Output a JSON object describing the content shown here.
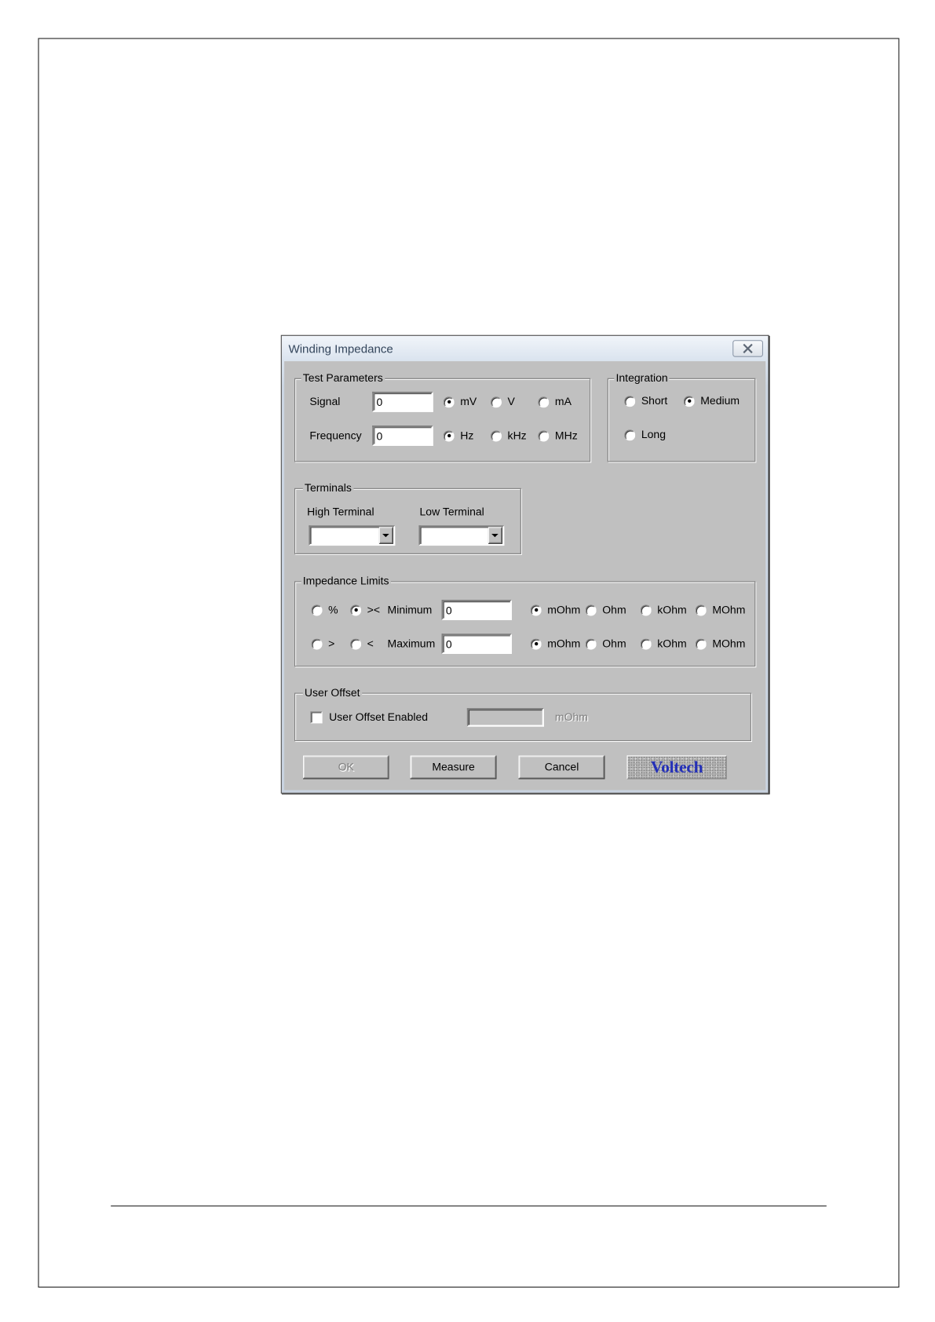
{
  "window": {
    "title": "Winding Impedance",
    "close_icon": "close-icon"
  },
  "test_parameters": {
    "label": "Test Parameters",
    "signal": {
      "label": "Signal",
      "value": "0",
      "units": [
        {
          "label": "mV",
          "selected": true
        },
        {
          "label": "V",
          "selected": false
        },
        {
          "label": "mA",
          "selected": false
        }
      ]
    },
    "frequency": {
      "label": "Frequency",
      "value": "0",
      "units": [
        {
          "label": "Hz",
          "selected": true
        },
        {
          "label": "kHz",
          "selected": false
        },
        {
          "label": "MHz",
          "selected": false
        }
      ]
    }
  },
  "integration": {
    "label": "Integration",
    "options": [
      {
        "label": "Short",
        "selected": false
      },
      {
        "label": "Medium",
        "selected": true
      },
      {
        "label": "Long",
        "selected": false
      }
    ]
  },
  "terminals": {
    "label": "Terminals",
    "high": {
      "label": "High Terminal",
      "value": ""
    },
    "low": {
      "label": "Low Terminal",
      "value": ""
    },
    "dropdown_icon": "dropdown-arrow-icon"
  },
  "impedance_limits": {
    "label": "Impedance Limits",
    "mode_options": [
      {
        "label": "%",
        "selected": false
      },
      {
        "label": "><",
        "selected": true
      },
      {
        "label": ">",
        "selected": false
      },
      {
        "label": "<",
        "selected": false
      }
    ],
    "minimum": {
      "label": "Minimum",
      "value": "0",
      "units": [
        {
          "label": "mOhm",
          "selected": true
        },
        {
          "label": "Ohm",
          "selected": false
        },
        {
          "label": "kOhm",
          "selected": false
        },
        {
          "label": "MOhm",
          "selected": false
        }
      ]
    },
    "maximum": {
      "label": "Maximum",
      "value": "0",
      "units": [
        {
          "label": "mOhm",
          "selected": true
        },
        {
          "label": "Ohm",
          "selected": false
        },
        {
          "label": "kOhm",
          "selected": false
        },
        {
          "label": "MOhm",
          "selected": false
        }
      ]
    }
  },
  "user_offset": {
    "label": "User Offset",
    "checkbox_label": "User Offset Enabled",
    "checked": false,
    "value": "",
    "value_enabled": false,
    "unit": "mOhm"
  },
  "buttons": {
    "ok": {
      "label": "OK",
      "enabled": false
    },
    "measure": {
      "label": "Measure",
      "enabled": true
    },
    "cancel": {
      "label": "Cancel",
      "enabled": true
    }
  },
  "logo": {
    "text": "Voltech"
  },
  "colors": {
    "dialog_bg": "#c0c0c0",
    "title_text": "#34465c",
    "logo_text": "#2430b8",
    "disabled_text": "#808080"
  }
}
